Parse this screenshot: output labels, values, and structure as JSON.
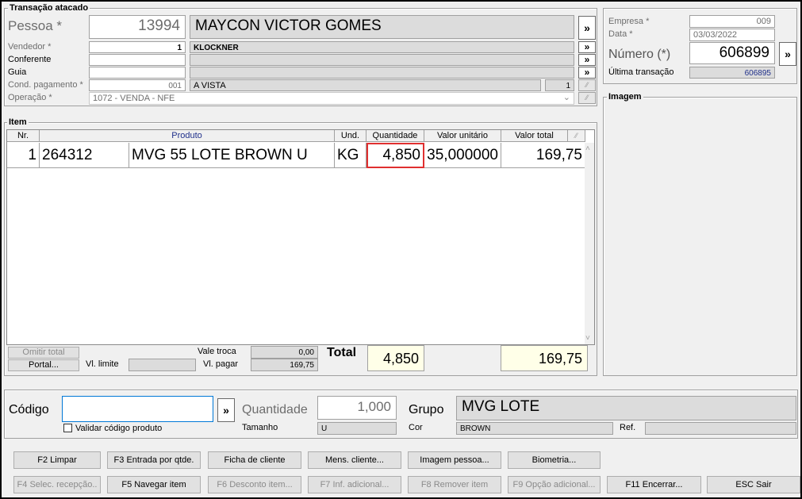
{
  "transacao": {
    "title": "Transação atacado",
    "pessoa_label": "Pessoa *",
    "pessoa_code": "13994",
    "pessoa_name": "MAYCON VICTOR GOMES",
    "vendedor_label": "Vendedor *",
    "vendedor_code": "1",
    "vendedor_name": "KLOCKNER",
    "conferente_label": "Conferente",
    "conferente_code": "",
    "conferente_name": "",
    "guia_label": "Guia",
    "guia_code": "",
    "guia_name": "",
    "cond_label": "Cond. pagamento *",
    "cond_code": "001",
    "cond_name": "A VISTA",
    "cond_parcelas": "1",
    "operacao_label": "Operação *",
    "operacao_value": "1072 - VENDA - NFE",
    "arrow": "»"
  },
  "header_right": {
    "empresa_label": "Empresa *",
    "empresa_value": "009",
    "data_label": "Data *",
    "data_value": "03/03/2022",
    "numero_label": "Número (*)",
    "numero_value": "606899",
    "ultima_label": "Última transação",
    "ultima_value": "606895",
    "arrow": "»"
  },
  "imagem": {
    "title": "Imagem"
  },
  "item": {
    "title": "Item",
    "columns": [
      "Nr.",
      "Produto",
      "Und.",
      "Quantidade",
      "Valor unitário",
      "Valor total"
    ],
    "rows": [
      {
        "nr": "1",
        "codigo": "264312",
        "produto": "MVG 55 LOTE BROWN U",
        "und": "KG",
        "quantidade": "4,850",
        "valor_unitario": "35,000000",
        "valor_total": "169,75"
      }
    ]
  },
  "totals": {
    "omitir_total": "Omitir total",
    "portal": "Portal...",
    "vl_limite_label": "Vl. limite",
    "vl_limite_value": "",
    "vale_troca_label": "Vale troca",
    "vale_troca_value": "0,00",
    "vl_pagar_label": "Vl. pagar",
    "vl_pagar_value": "169,75",
    "total_label": "Total",
    "total_qtd": "4,850",
    "total_valor": "169,75"
  },
  "entry": {
    "codigo_label": "Código",
    "codigo_value": "",
    "arrow": "»",
    "validar_label": "Validar código produto",
    "quantidade_label": "Quantidade",
    "quantidade_value": "1,000",
    "tamanho_label": "Tamanho",
    "tamanho_value": "U",
    "grupo_label": "Grupo",
    "grupo_value": "MVG LOTE",
    "cor_label": "Cor",
    "cor_value": "BROWN",
    "ref_label": "Ref.",
    "ref_value": ""
  },
  "buttons": {
    "f2": "F2 Limpar",
    "f3": "F3 Entrada por qtde.",
    "ficha": "Ficha de cliente",
    "mens": "Mens. cliente...",
    "imagem_pessoa": "Imagem pessoa...",
    "biometria": "Biometria...",
    "f4": "F4 Selec. recepção..",
    "f5": "F5 Navegar item",
    "f6": "F6 Desconto item...",
    "f7": "F7 Inf. adicional...",
    "f8": "F8 Remover item",
    "f9": "F9 Opção adicional...",
    "f11": "F11 Encerrar...",
    "esc": "ESC Sair"
  },
  "colors": {
    "quantity_highlight": "#e03030",
    "readonly_bg": "#dcdcdc",
    "total_bg": "#ffffe8",
    "link_navy": "#1f2f8a"
  }
}
